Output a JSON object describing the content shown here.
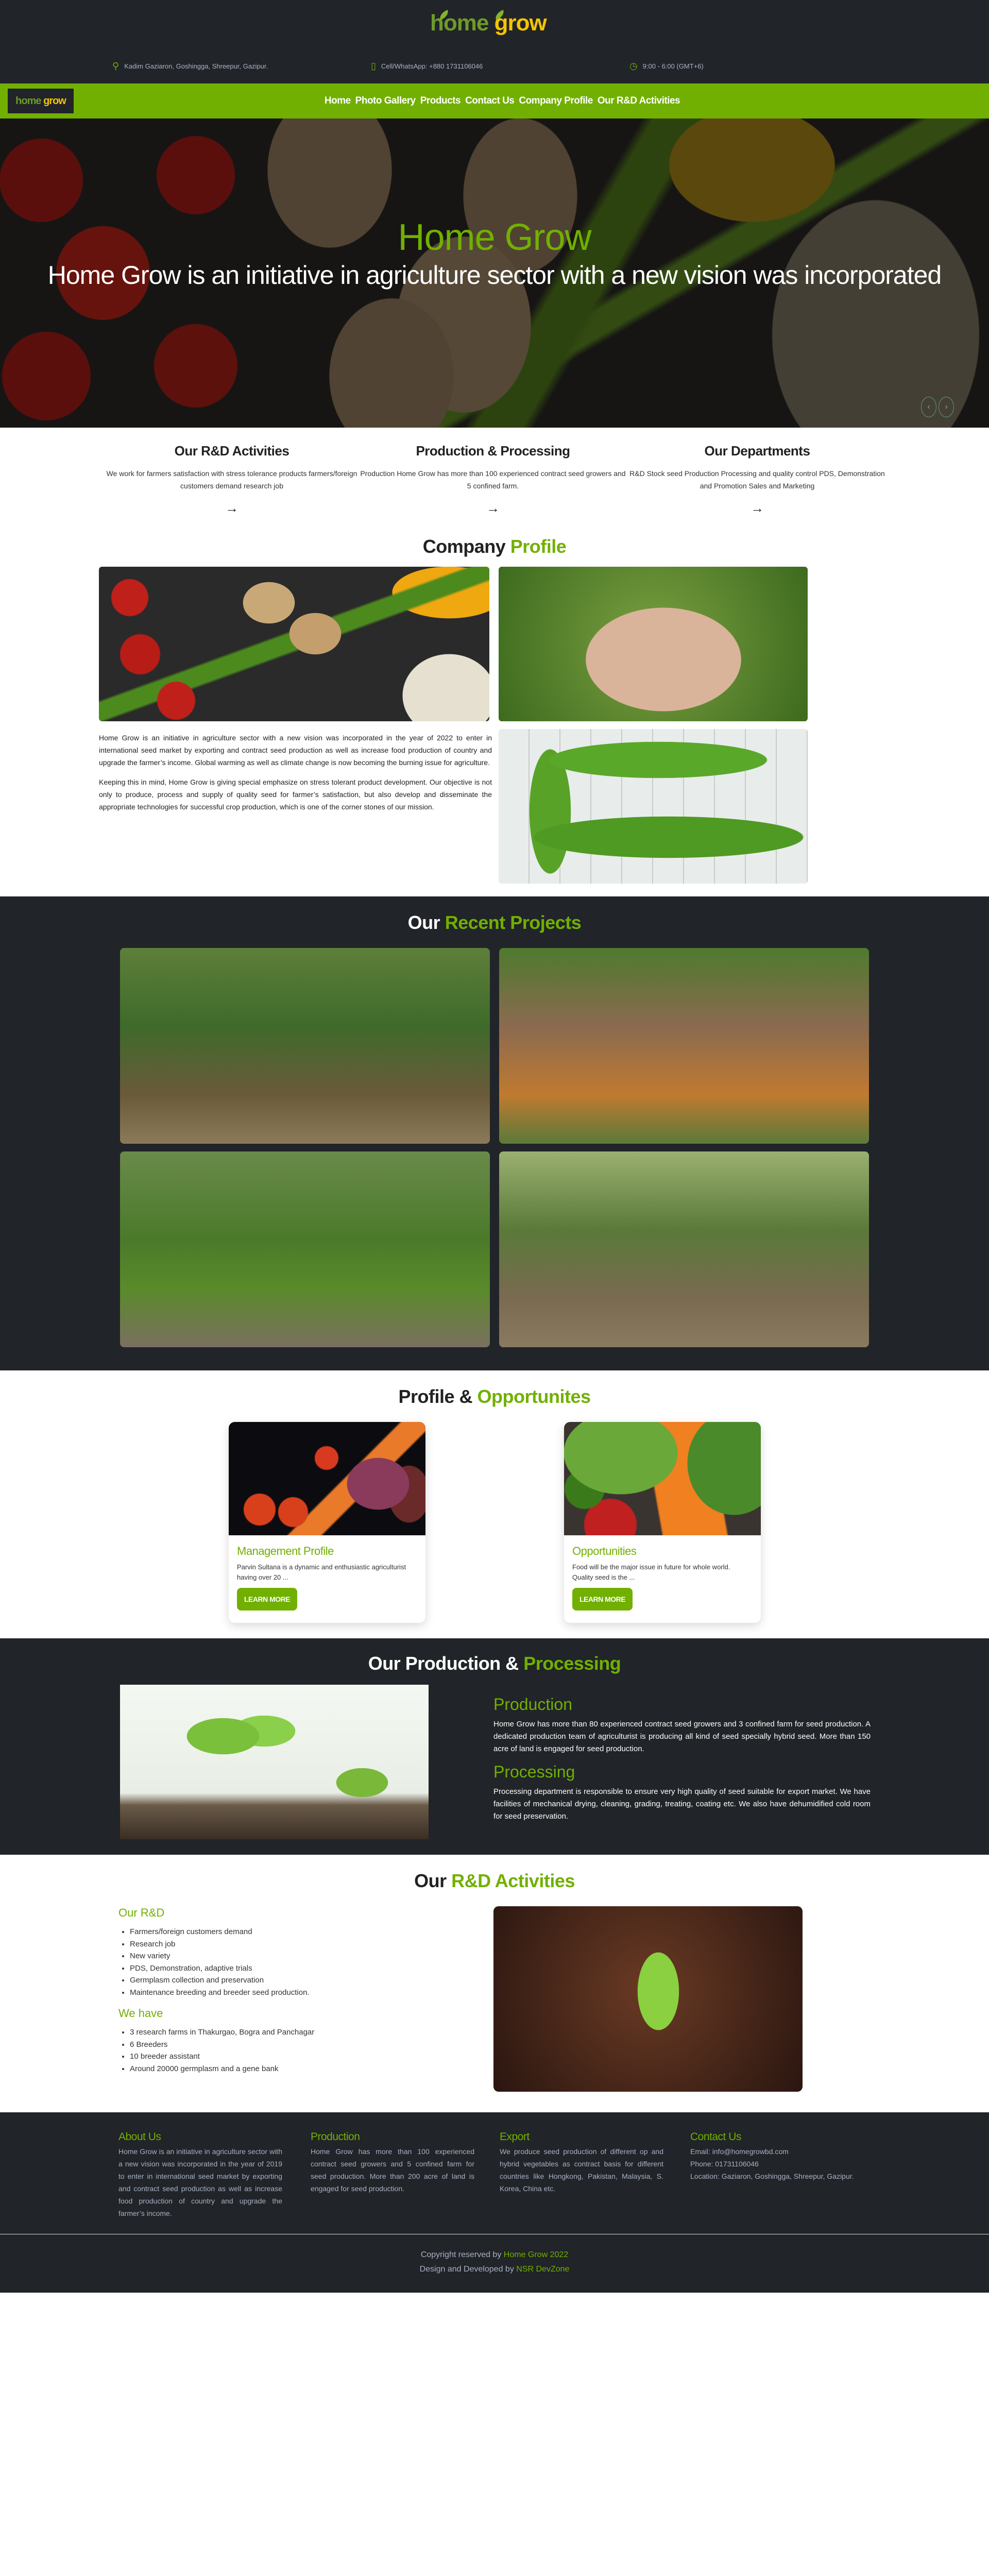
{
  "brand": {
    "logo_home": "home",
    "logo_grow": "grow"
  },
  "topbar": {
    "address": "Kadim Gaziaron, Goshingga, Shreepur, Gazipur.",
    "phone": "Cell/WhatsApp: +880 1731106046",
    "hours": "9:00 - 6:00 (GMT+6)"
  },
  "nav": {
    "items": [
      "Home",
      "Photo Gallery",
      "Products",
      "Contact Us",
      "Company Profile",
      "Our R&D Activities"
    ]
  },
  "hero": {
    "title": "Home Grow",
    "subtitle": "Home Grow is an initiative in agriculture sector with a new vision was incorporated",
    "prev": "‹",
    "next": "›"
  },
  "features": [
    {
      "title": "Our R&D Activities",
      "text": "We work for farmers satisfaction with stress tolerance products farmers/foreign customers demand research job"
    },
    {
      "title": "Production & Processing",
      "text": "Production Home Grow has more than 100 experienced contract seed growers and 5 confined farm."
    },
    {
      "title": "Our Departments",
      "text": "R&D Stock seed Production Processing and quality control PDS, Demonstration and Promotion Sales and Marketing"
    }
  ],
  "company_profile": {
    "title_a": "Company",
    "title_b": "Profile",
    "p1": "Home Grow is an initiative in agriculture sector with a new vision was incorporated in the year of 2022 to enter in international seed market by exporting and contract seed production as well as increase food production of country and upgrade the farmer’s income. Global warming as well as climate change is now becoming the burning issue for agriculture.",
    "p2": "Keeping this in mind, Home Grow is giving special emphasize on stress tolerant product development. Our objective is not only to produce, process and supply of quality seed for farmer’s satisfaction, but also develop and disseminate the appropriate technologies for successful crop production, which is one of the corner stones of our mission."
  },
  "projects": {
    "title_a": "Our",
    "title_b": "Recent Projects"
  },
  "profile_opps": {
    "title_a": "Profile &",
    "title_b": "Opportunites",
    "cards": [
      {
        "title": "Management Profile",
        "text": "Parvin Sultana is a dynamic and enthusiastic agriculturist having over 20 ...",
        "button": "LEARN MORE"
      },
      {
        "title": "Opportunities",
        "text": "Food will be the major issue in future for whole world. Quality seed is the ...",
        "button": "LEARN MORE"
      }
    ]
  },
  "production": {
    "title_a": "Our Production &",
    "title_b": "Processing",
    "prod_title": "Production",
    "prod_text": "Home Grow has more than 80 experienced contract seed growers and 3 confined farm for seed production. A dedicated production team of agriculturist is producing all kind of seed specially hybrid seed. More than 150 acre of land is engaged for seed production.",
    "proc_title": "Processing",
    "proc_text": "Processing department is responsible to ensure very high quality of seed suitable for export market. We have facilities of mechanical drying, cleaning, grading, treating, coating etc. We also have dehumidified cold room for seed preservation."
  },
  "rnd": {
    "title_a": "Our",
    "title_b": "R&D Activities",
    "h1": "Our R&D",
    "list1": [
      "Farmers/foreign customers demand",
      "Research job",
      "New variety",
      "PDS, Demonstration, adaptive trials",
      "Germplasm collection and preservation",
      "Maintenance breeding and breeder seed production."
    ],
    "h2": "We have",
    "list2": [
      "3 research farms in Thakurgao, Bogra and Panchagar",
      "6 Breeders",
      "10 breeder assistant",
      "Around 20000 germplasm and a gene bank"
    ]
  },
  "footer": {
    "cols": [
      {
        "title": "About Us",
        "text": "Home Grow is an initiative in agriculture sector with a new vision was incorporated in the year of 2019 to enter in international seed market by exporting and contract seed production as well as increase food production of country and upgrade the farmer’s income."
      },
      {
        "title": "Production",
        "text": "Home Grow has more than 100 experienced contract seed growers and 5 confined farm for seed production. More than 200 acre of land is engaged for seed production."
      },
      {
        "title": "Export",
        "text": "We produce seed production of different op and hybrid vegetables as contract basis for different countries like Hongkong, Pakistan, Malaysia, S. Korea, China etc."
      }
    ],
    "contact_title": "Contact Us",
    "email": "Email: info@homegrowbd.com",
    "phone": "Phone: 01731106046",
    "location": "Location: Gaziaron, Goshingga, Shreepur, Gazipur.",
    "copy_a": "Copyright reserved by",
    "copy_b": "Home Grow 2022",
    "dev_a": "Design and Developed by",
    "dev_b": "NSR DevZone"
  },
  "colors": {
    "accent": "#71b000",
    "dark": "#212428"
  }
}
